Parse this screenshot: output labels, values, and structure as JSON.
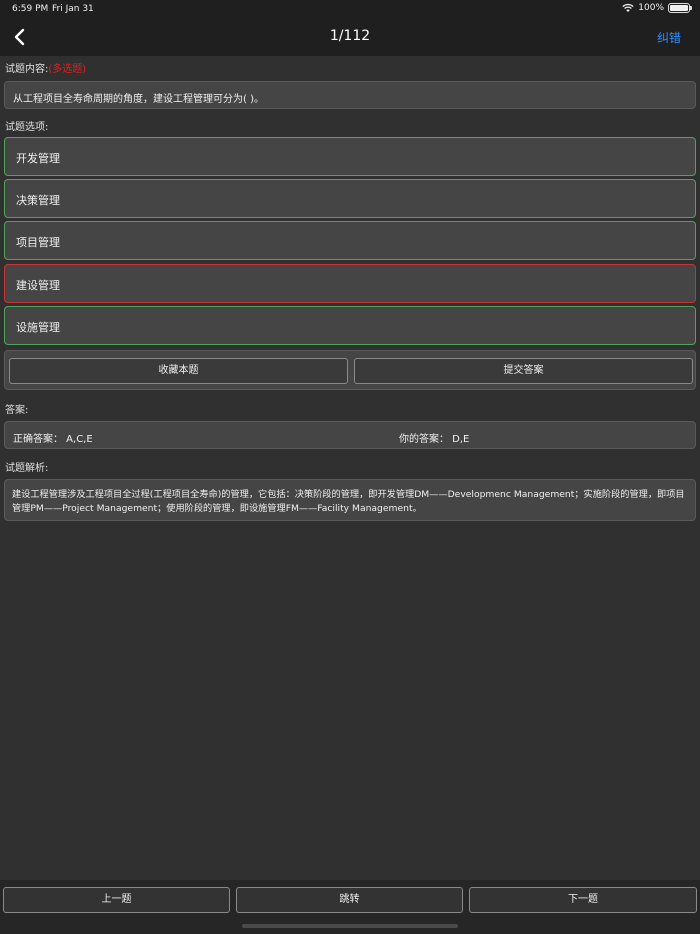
{
  "status": {
    "time": "6:59 PM",
    "date": "Fri Jan 31",
    "battery": "100%"
  },
  "nav": {
    "title": "1/112",
    "correction": "纠错"
  },
  "question": {
    "label": "试题内容:",
    "type_tag": "(多选题)",
    "text": "从工程项目全寿命周期的角度，建设工程管理可分为(    )。"
  },
  "options": {
    "label": "试题选项:",
    "items": [
      {
        "text": "开发管理",
        "state": "correct"
      },
      {
        "text": "决策管理",
        "state": "correct"
      },
      {
        "text": "项目管理",
        "state": "correct"
      },
      {
        "text": "建设管理",
        "state": "wrong"
      },
      {
        "text": "设施管理",
        "state": "correct"
      }
    ]
  },
  "actions": {
    "favorite": "收藏本题",
    "submit": "提交答案"
  },
  "answer": {
    "label": "答案:",
    "correct": "正确答案： A,C,E",
    "yours": "你的答案： D,E"
  },
  "analysis": {
    "label": "试题解析:",
    "text": "建设工程管理涉及工程项目全过程(工程项目全寿命)的管理，它包括：决策阶段的管理，即开发管理DM——Developmenc Management；实施阶段的管理，即项目管理PM——Project Management；使用阶段的管理，即设施管理FM——Facility Management。"
  },
  "bottom": {
    "prev": "上一题",
    "jump": "跳转",
    "next": "下一题"
  },
  "colors": {
    "accent": "#2f8fff",
    "correct_border": "#4fa35a",
    "wrong_border": "#c83232",
    "tag": "#e02020"
  }
}
